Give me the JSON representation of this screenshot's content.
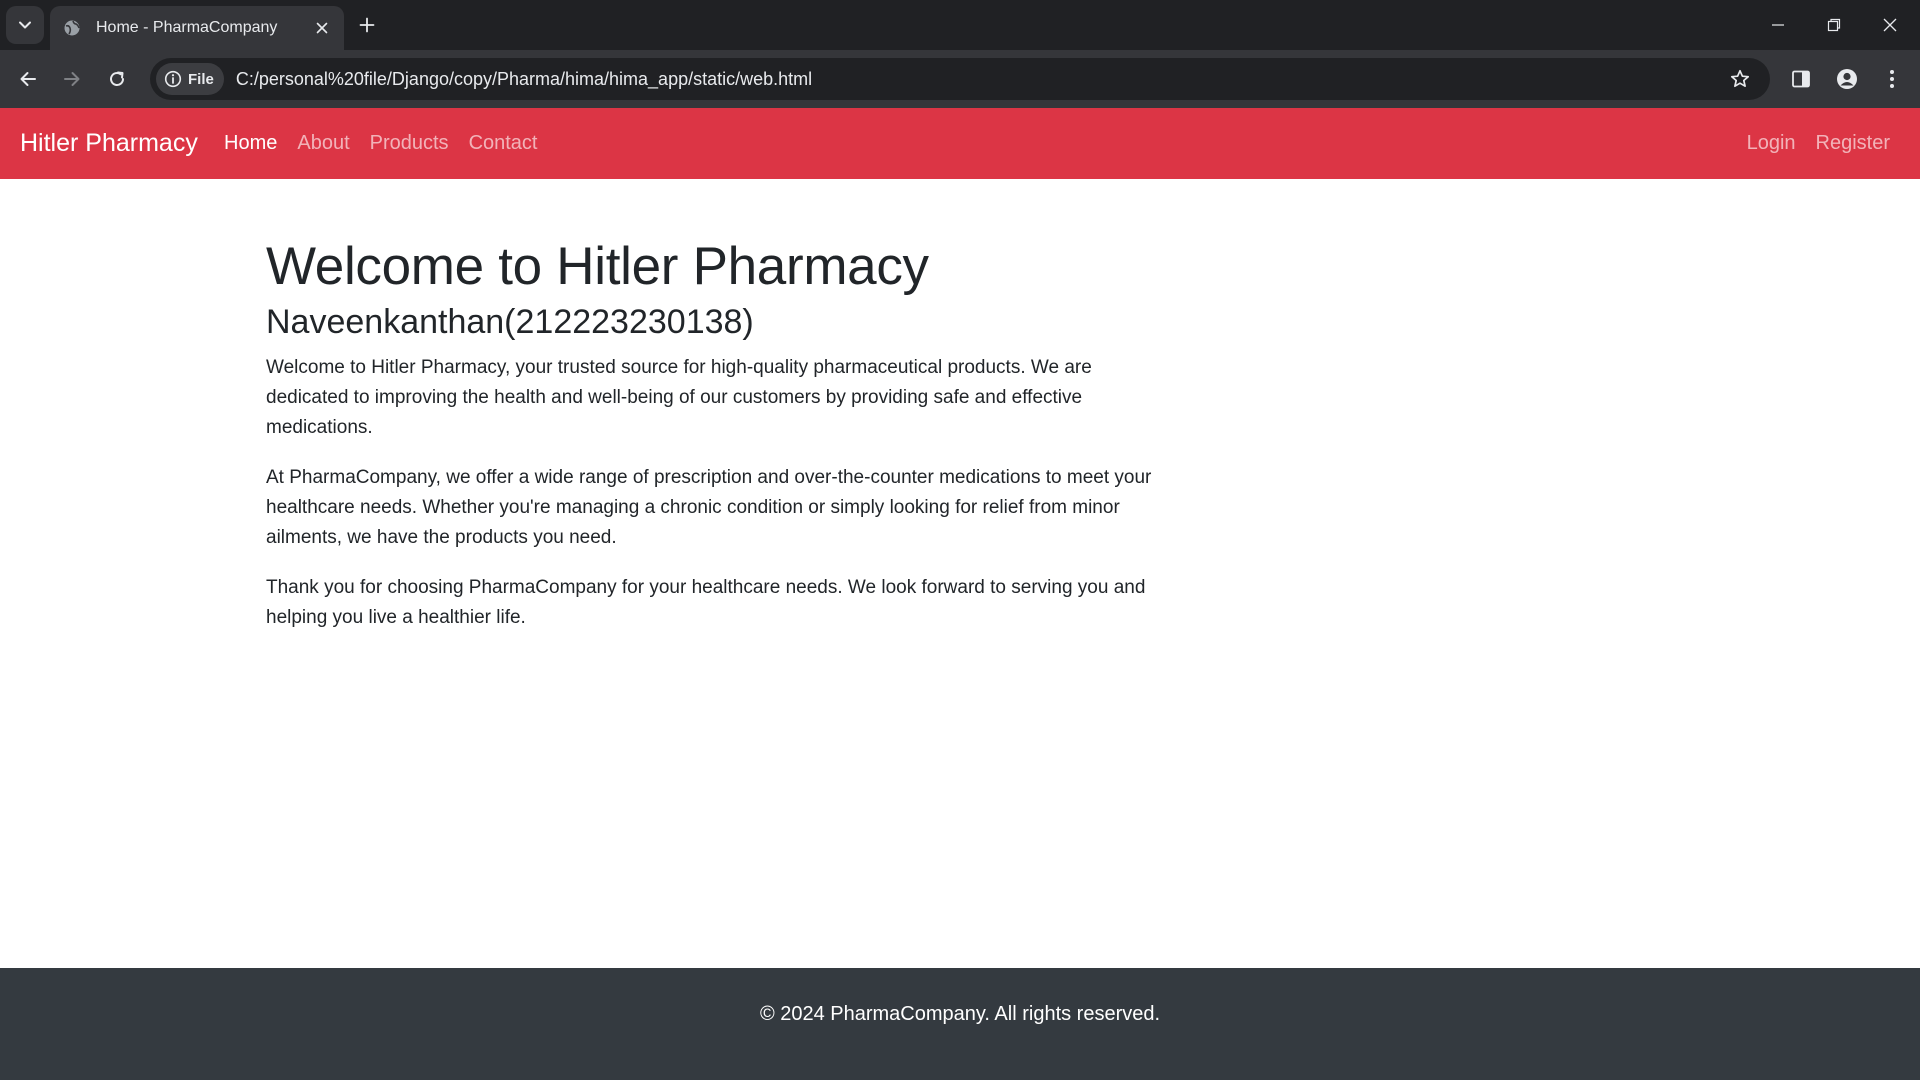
{
  "browser": {
    "tab_title": "Home - PharmaCompany",
    "site_chip": "File",
    "url": "C:/personal%20file/Django/copy/Pharma/hima/hima_app/static/web.html"
  },
  "navbar": {
    "brand": "Hitler Pharmacy",
    "links": [
      "Home",
      "About",
      "Products",
      "Contact"
    ],
    "active_link": "Home",
    "right_links": [
      "Login",
      "Register"
    ],
    "background_color": "#dc3545"
  },
  "main": {
    "heading": "Welcome to Hitler Pharmacy",
    "subheading": "Naveenkanthan(212223230138)",
    "paragraphs": [
      "Welcome to Hitler Pharmacy, your trusted source for high-quality pharmaceutical products. We are dedicated to improving the health and well-being of our customers by providing safe and effective medications.",
      "At PharmaCompany, we offer a wide range of prescription and over-the-counter medications to meet your healthcare needs. Whether you're managing a chronic condition or simply looking for relief from minor ailments, we have the products you need.",
      "Thank you for choosing PharmaCompany for your healthcare needs. We look forward to serving you and helping you live a healthier life."
    ]
  },
  "footer": {
    "text": "© 2024 PharmaCompany. All rights reserved.",
    "background_color": "#343a40"
  }
}
